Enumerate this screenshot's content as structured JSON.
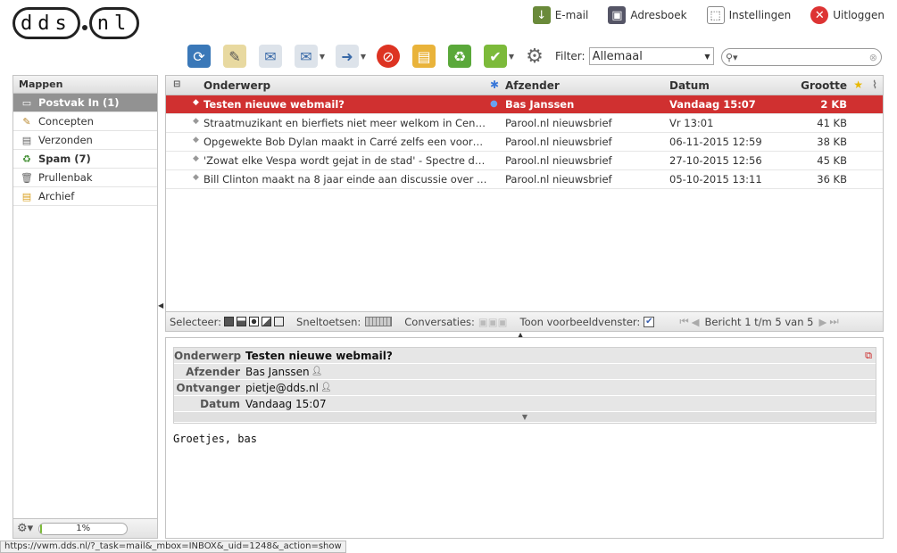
{
  "logo": {
    "part1": "dds",
    "part2": "nl"
  },
  "topnav": [
    {
      "label": "E-mail",
      "icon": "mail-download-icon"
    },
    {
      "label": "Adresboek",
      "icon": "addressbook-icon"
    },
    {
      "label": "Instellingen",
      "icon": "settings-icon"
    },
    {
      "label": "Uitloggen",
      "icon": "logout-icon"
    }
  ],
  "filter": {
    "label": "Filter:",
    "value": "Allemaal"
  },
  "search": {
    "placeholder": ""
  },
  "folders": {
    "title": "Mappen",
    "items": [
      {
        "label": "Postvak In (1)",
        "icon": "inbox-icon",
        "active": true
      },
      {
        "label": "Concepten",
        "icon": "pencil-icon"
      },
      {
        "label": "Verzonden",
        "icon": "sent-icon"
      },
      {
        "label": "Spam (7)",
        "icon": "spam-icon",
        "bold": true
      },
      {
        "label": "Prullenbak",
        "icon": "trash-icon"
      },
      {
        "label": "Archief",
        "icon": "archive-icon"
      }
    ],
    "quota": "1%"
  },
  "list": {
    "columns": {
      "subject": "Onderwerp",
      "from": "Afzender",
      "date": "Datum",
      "size": "Grootte"
    },
    "rows": [
      {
        "subject": "Testen nieuwe webmail?",
        "from": "Bas Janssen",
        "date": "Vandaag 15:07",
        "size": "2 KB",
        "selected": true
      },
      {
        "subject": "Straatmuzikant en bierfiets niet meer welkom in Cent…",
        "from": "Parool.nl nieuwsbrief",
        "date": "Vr 13:01",
        "size": "41 KB"
      },
      {
        "subject": "Opgewekte Bob Dylan maakt in Carré zelfs een voor…",
        "from": "Parool.nl nieuwsbrief",
        "date": "06-11-2015 12:59",
        "size": "38 KB"
      },
      {
        "subject": "'Zowat elke Vespa wordt gejat in de stad' - Spectre d…",
        "from": "Parool.nl nieuwsbrief",
        "date": "27-10-2015 12:56",
        "size": "45 KB"
      },
      {
        "subject": "Bill Clinton maakt na 8 jaar einde aan discussie over …",
        "from": "Parool.nl nieuwsbrief",
        "date": "05-10-2015 13:11",
        "size": "36 KB"
      }
    ],
    "footer": {
      "select_label": "Selecteer:",
      "shortcuts_label": "Sneltoetsen:",
      "conversations_label": "Conversaties:",
      "preview_label": "Toon voorbeeldvenster:",
      "paging": "Bericht 1 t/m 5 van 5"
    }
  },
  "preview": {
    "subject_label": "Onderwerp",
    "subject": "Testen nieuwe webmail?",
    "from_label": "Afzender",
    "from": "Bas Janssen",
    "to_label": "Ontvanger",
    "to": "pietje@dds.nl",
    "date_label": "Datum",
    "date": "Vandaag 15:07",
    "body": "Groetjes, bas"
  },
  "statusbar": "https://vwm.dds.nl/?_task=mail&_mbox=INBOX&_uid=1248&_action=show",
  "colors": {
    "selected_row": "#d03030",
    "active_folder": "#929292"
  }
}
